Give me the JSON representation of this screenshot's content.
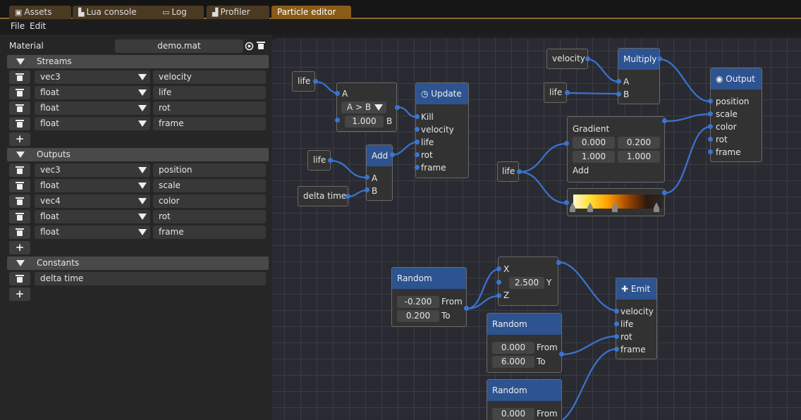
{
  "tabs": [
    {
      "label": "Assets",
      "icon": "image-icon"
    },
    {
      "label": "Lua console",
      "icon": "console-icon"
    },
    {
      "label": "Log",
      "icon": "chat-icon"
    },
    {
      "label": "Profiler",
      "icon": "chart-icon"
    },
    {
      "label": "Particle editor",
      "icon": ""
    }
  ],
  "menu": {
    "file": "File",
    "edit": "Edit"
  },
  "material": {
    "label": "Material",
    "value": "demo.mat"
  },
  "streams": {
    "header": "Streams",
    "items": [
      {
        "type": "vec3",
        "name": "velocity"
      },
      {
        "type": "float",
        "name": "life"
      },
      {
        "type": "float",
        "name": "rot"
      },
      {
        "type": "float",
        "name": "frame"
      }
    ]
  },
  "outputs": {
    "header": "Outputs",
    "items": [
      {
        "type": "vec3",
        "name": "position"
      },
      {
        "type": "float",
        "name": "scale"
      },
      {
        "type": "vec4",
        "name": "color"
      },
      {
        "type": "float",
        "name": "rot"
      },
      {
        "type": "float",
        "name": "frame"
      }
    ]
  },
  "constants": {
    "header": "Constants",
    "items": [
      "delta time"
    ]
  },
  "add_label": "+",
  "nodes": {
    "life1": "life",
    "compare": {
      "a": "A",
      "op": "A > B",
      "value": "1.000",
      "b": "B"
    },
    "update": {
      "title": "Update",
      "pins": [
        "Kill",
        "velocity",
        "life",
        "rot",
        "frame"
      ]
    },
    "life2": "life",
    "add": {
      "title": "Add",
      "a": "A",
      "b": "B"
    },
    "delta": "delta time",
    "velocity": "velocity",
    "life3": "life",
    "multiply": {
      "title": "Multiply",
      "a": "A",
      "b": "B"
    },
    "output": {
      "title": "Output",
      "pins": [
        "position",
        "scale",
        "color",
        "rot",
        "frame"
      ]
    },
    "gradient": {
      "title": "Gradient",
      "values": [
        "0.000",
        "0.200",
        "1.000",
        "1.000"
      ],
      "add": "Add"
    },
    "life4": "life",
    "random1": {
      "title": "Random",
      "from": "-0.200",
      "to": "0.200",
      "from_label": "From",
      "to_label": "To"
    },
    "xyz": {
      "x": "X",
      "y_value": "2.500",
      "y": "Y",
      "z": "Z"
    },
    "emit": {
      "title": "Emit",
      "pins": [
        "velocity",
        "life",
        "rot",
        "frame"
      ]
    },
    "random2": {
      "title": "Random",
      "from": "0.000",
      "to": "6.000",
      "from_label": "From",
      "to_label": "To"
    },
    "random3": {
      "title": "Random",
      "from": "0.000",
      "from_label": "From"
    }
  },
  "colors": {
    "accent_tab": "#8a5c19",
    "node_header": "#2d5390",
    "wire": "#3a74d2"
  }
}
